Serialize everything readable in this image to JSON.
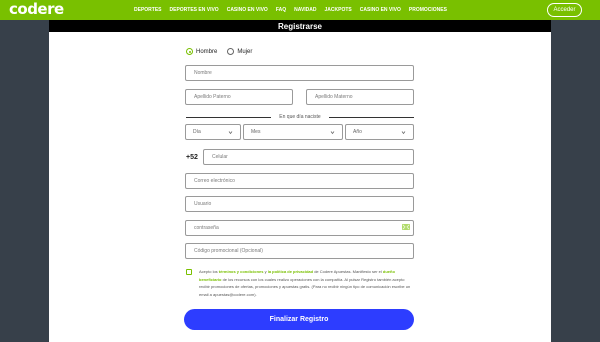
{
  "brand": {
    "logo_text": "codere",
    "accent": "#79c000",
    "button_blue": "#2d3dff"
  },
  "nav": {
    "items": [
      "Deportes",
      "Deportes en vivo",
      "Casino en vivo",
      "FAQ",
      "Navidad",
      "Jackpots",
      "Casino en vivo",
      "Promociones"
    ],
    "login_label": "Acceder"
  },
  "page": {
    "title": "Registrarse"
  },
  "form": {
    "gender": {
      "options": [
        "Hombre",
        "Mujer"
      ],
      "selected": "Hombre"
    },
    "nombre_placeholder": "Nombre",
    "apellido_paterno_placeholder": "Apellido Paterno",
    "apellido_materno_placeholder": "Apellido Materno",
    "dob_label": "En que día naciste",
    "dob": {
      "day": "Día",
      "month": "Mes",
      "year": "Año"
    },
    "phone_prefix": "+52",
    "celular_placeholder": "Celular",
    "email_placeholder": "Correo electrónico",
    "usuario_placeholder": "Usuario",
    "password_placeholder": "contraseña",
    "promo_placeholder": "Código promocional (Opcional)",
    "terms": {
      "part1": "Acepto los ",
      "link1": "términos y condiciones",
      "part2": " y ",
      "link2": "la política de privacidad",
      "part3": " de Codere Apuestas. Manifiesto ser el ",
      "link3": "dueño beneficiario",
      "part4": " de los recursos con los cuales realizo operaciones con la compañía. Al pulsar Registro también acepto recibir promociones de ofertas, promociones y apuestas gratis. (Para no recibir ningún tipo de comunicación escribe un email a apuestas@codere.com)."
    },
    "submit_label": "Finalizar Registro"
  },
  "icons": {
    "eye": "eye-icon",
    "chevron": "chevron-down-icon",
    "radio": "radio-icon",
    "checkbox": "checkbox-icon"
  }
}
